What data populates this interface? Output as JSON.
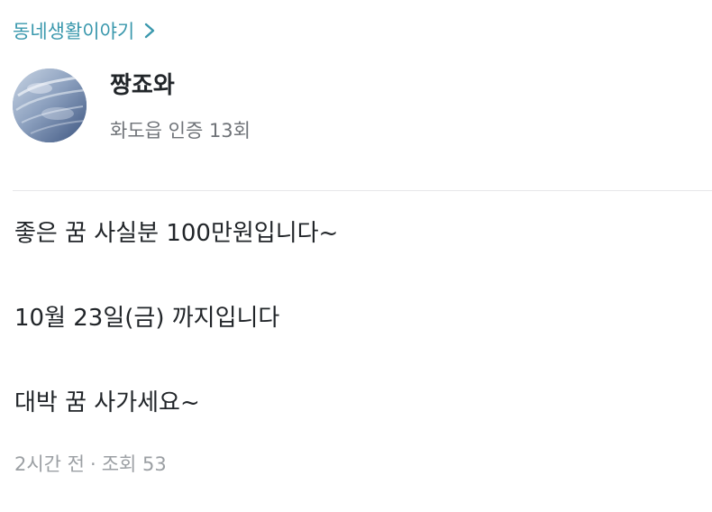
{
  "category": {
    "label": "동네생활이야기",
    "icon": "chevron-right-icon",
    "color": "#3a98ad"
  },
  "author": {
    "avatar_icon": "avatar-photo-sky",
    "name": "짱죠와",
    "location_verification": "화도읍 인증 13회"
  },
  "post": {
    "lines": [
      "좋은 꿈 사실분 100만원입니다~",
      "10월 23일(금) 까지입니다",
      "대박 꿈 사가세요~"
    ]
  },
  "footer": {
    "time": "2시간 전",
    "separator": "·",
    "views": "조회 53"
  }
}
